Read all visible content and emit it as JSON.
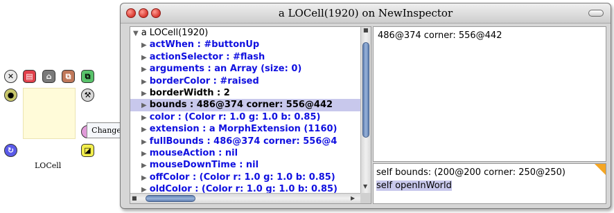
{
  "morph": {
    "label": "LOCell",
    "fill_color": "#fffbd9"
  },
  "halo": {
    "tooltip": "Change size",
    "handles": [
      {
        "name": "close-handle-icon",
        "glyph": "✕"
      },
      {
        "name": "menu-handle-icon",
        "glyph": "▤"
      },
      {
        "name": "pick-up-handle-icon",
        "glyph": "⌂"
      },
      {
        "name": "collapse-handle-icon",
        "glyph": "⧉"
      },
      {
        "name": "duplicate-handle-icon",
        "glyph": "⧉"
      },
      {
        "name": "debug-handle-icon",
        "glyph": "●"
      },
      {
        "name": "tool-handle-icon",
        "glyph": "⚒"
      },
      {
        "name": "rotate-handle-icon",
        "glyph": "↻"
      },
      {
        "name": "resize-handle-icon",
        "glyph": "◪"
      },
      {
        "name": "color-handle-icon",
        "glyph": ""
      }
    ]
  },
  "window": {
    "title": "a LOCell(1920) on NewInspector",
    "list": {
      "root": "a LOCell(1920)",
      "items": [
        "actWhen : #buttonUp",
        "actionSelector : #flash",
        "arguments : an Array (size: 0)",
        "borderColor : #raised",
        "borderWidth : 2",
        "bounds : 486@374 corner: 556@442",
        "color : (Color r: 1.0 g: 1.0 b: 0.85)",
        "extension : a MorphExtension (1160)",
        "fullBounds : 486@374 corner: 556@4",
        "mouseAction : nil",
        "mouseDownTime : nil",
        "offColor : (Color r: 1.0 g: 1.0 b: 0.85)",
        "oldColor : (Color r: 1.0 g: 1.0 b: 0.85)"
      ],
      "selected_index": 5
    },
    "value_text": "486@374 corner: 556@442",
    "eval_lines": [
      "self bounds: (200@200 corner: 250@250)",
      "self openInWorld"
    ]
  },
  "colors": {
    "link_text": "#1010e0",
    "selection": "#c8c8ec",
    "scroll_thumb": "#7a98c8",
    "close_button": "#d8382f"
  }
}
